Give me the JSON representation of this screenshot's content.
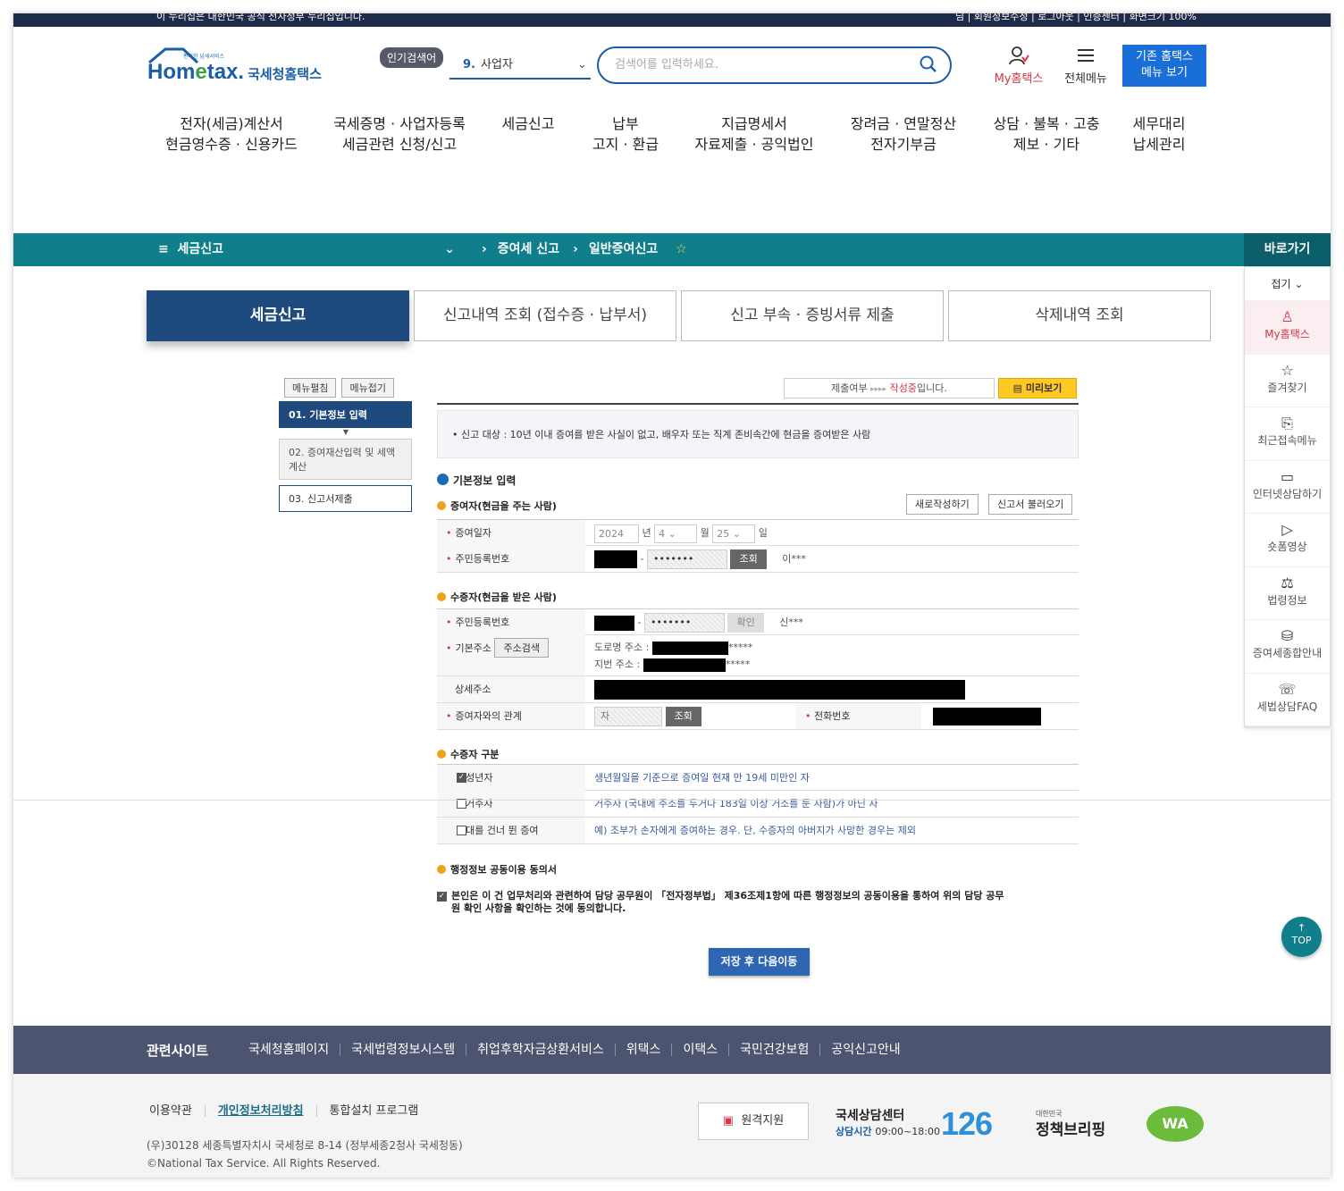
{
  "topbar": {
    "notice": "이 누리집은 대한민국 공식 전자정부 누리집입니다.",
    "rights": "님 | 회원정보수정 | 로그아웃 | 인증센터 | 화면크기 100%"
  },
  "header": {
    "logo_small": "편리한 납세서비스",
    "logo_home": "Hom",
    "logo_e": "e",
    "logo_tax": "tax.",
    "logo_nts": "국세청홈택스",
    "popular_label": "인기검색어",
    "popular_num": "9.",
    "popular_item": "사업자",
    "search_placeholder": "검색어를 입력하세요.",
    "my_label": "My홈택스",
    "all_menu_label": "전체메뉴",
    "old_menu_line1": "기존 홈택스",
    "old_menu_line2": "메뉴 보기"
  },
  "gnb": [
    {
      "l1": "전자(세금)계산서",
      "l2": "현금영수증 · 신용카드"
    },
    {
      "l1": "국세증명 · 사업자등록",
      "l2": "세금관련 신청/신고"
    },
    {
      "l1": "세금신고",
      "l2": ""
    },
    {
      "l1": "납부",
      "l2": "고지 · 환급"
    },
    {
      "l1": "지급명세서",
      "l2": "자료제출 · 공익법인"
    },
    {
      "l1": "장려금 · 연말정산",
      "l2": "전자기부금"
    },
    {
      "l1": "상담 · 불복 · 고충",
      "l2": "제보 · 기타"
    },
    {
      "l1": "세무대리",
      "l2": "납세관리"
    }
  ],
  "breadcrumb": {
    "menu": "세금신고",
    "level2": "증여세 신고",
    "level3": "일반증여신고"
  },
  "quick": {
    "title": "바로가기",
    "fold": "접기",
    "items": [
      "My홈택스",
      "즐겨찾기",
      "최근접속메뉴",
      "인터넷상담하기",
      "숏폼영상",
      "법령정보",
      "증여세종합안내",
      "세법상담FAQ"
    ]
  },
  "tabs": [
    "세금신고",
    "신고내역 조회 (접수증 · 납부서)",
    "신고 부속 · 증빙서류 제출",
    "삭제내역 조회"
  ],
  "leftmenu": {
    "expand": "메뉴펼침",
    "collapse": "메뉴접기",
    "steps": [
      "01. 기본정보 입력",
      "02. 증여재산입력 및 세액계산",
      "03. 신고서제출"
    ]
  },
  "form": {
    "status_label": "제출여부",
    "status_arrows": "▸▸▸▸",
    "status_value": "작성중",
    "status_suffix": "입니다.",
    "preview": "미리보기",
    "info": "• 신고 대상 : 10년 이내 증여를 받은 사실이 없고, 배우자 또는 직계 존비속간에 현금을 증여받은 사람",
    "sec_basic": "기본정보 입력",
    "sec_donor": "증여자(현금을 주는 사람)",
    "new_btn": "새로작성하기",
    "load_btn": "신고서 불러오기",
    "gift_date_label": "증여일자",
    "year": "2024",
    "year_unit": "년",
    "month": "4",
    "month_unit": "월",
    "day": "25",
    "day_unit": "일",
    "rrn_label": "주민등록번호",
    "rrn_mask": "•••••••",
    "lookup_btn": "조회",
    "donor_name": "이***",
    "sec_donee": "수증자(현금을 받은 사람)",
    "confirm_btn": "확인",
    "donee_name": "신***",
    "addr_label": "기본주소",
    "addr_search": "주소검색",
    "road_label": "도로명 주소 :",
    "road_tail": "*****",
    "lot_label": "지번 주소 :",
    "lot_tail": "*****",
    "detail_label": "상세주소",
    "relation_label": "증여자와의 관계",
    "relation_value": "자",
    "phone_label": "전화번호",
    "sec_type": "수증자 구분",
    "types": [
      {
        "label": "미성년자",
        "desc": "생년월일을 기준으로 증여일 현재 만 19세 미만인 자",
        "checked": true
      },
      {
        "label": "비거주자",
        "desc": "거주자 (국내에 주소를 두거나 183일 이상 거소를 둔 사람)가 아닌 자",
        "checked": false
      },
      {
        "label": "세대를 건너 뛴 증여",
        "desc": "예) 조부가 손자에게 증여하는 경우. 단, 수증자의 아버지가 사망한 경우는 제외",
        "checked": false
      }
    ],
    "sec_agree": "행정정보 공동이용 동의서",
    "agree_text": "본인은 이 건 업무처리와 관련하여 담당 공무원이 「전자정부법」 제36조제1항에 따른 행정정보의 공동이용을 통하여 위의 담당 공무원 확인 사항을 확인하는 것에 동의합니다.",
    "save_btn": "저장 후 다음이동"
  },
  "top_btn": "TOP",
  "related": {
    "title": "관련사이트",
    "links": [
      "국세청홈페이지",
      "국세법령정보시스템",
      "취업후학자금상환서비스",
      "위택스",
      "이택스",
      "국민건강보험",
      "공익신고안내"
    ]
  },
  "footer": {
    "links": [
      "이용약관",
      "개인정보처리방침",
      "통합설치 프로그램"
    ],
    "address": "(우)30128 세종특별자치시 국세청로 8-14 (정부세종2청사 국세청동)",
    "copyright": "©National Tax Service. All Rights Reserved.",
    "remote": "원격지원",
    "cc_title": "국세상담센터",
    "cc_hours_label": "상담시간",
    "cc_hours": "09:00~18:00",
    "cc_number": "126",
    "brief_small": "대한민국",
    "brief": "정책브리핑",
    "wa": "WA"
  }
}
